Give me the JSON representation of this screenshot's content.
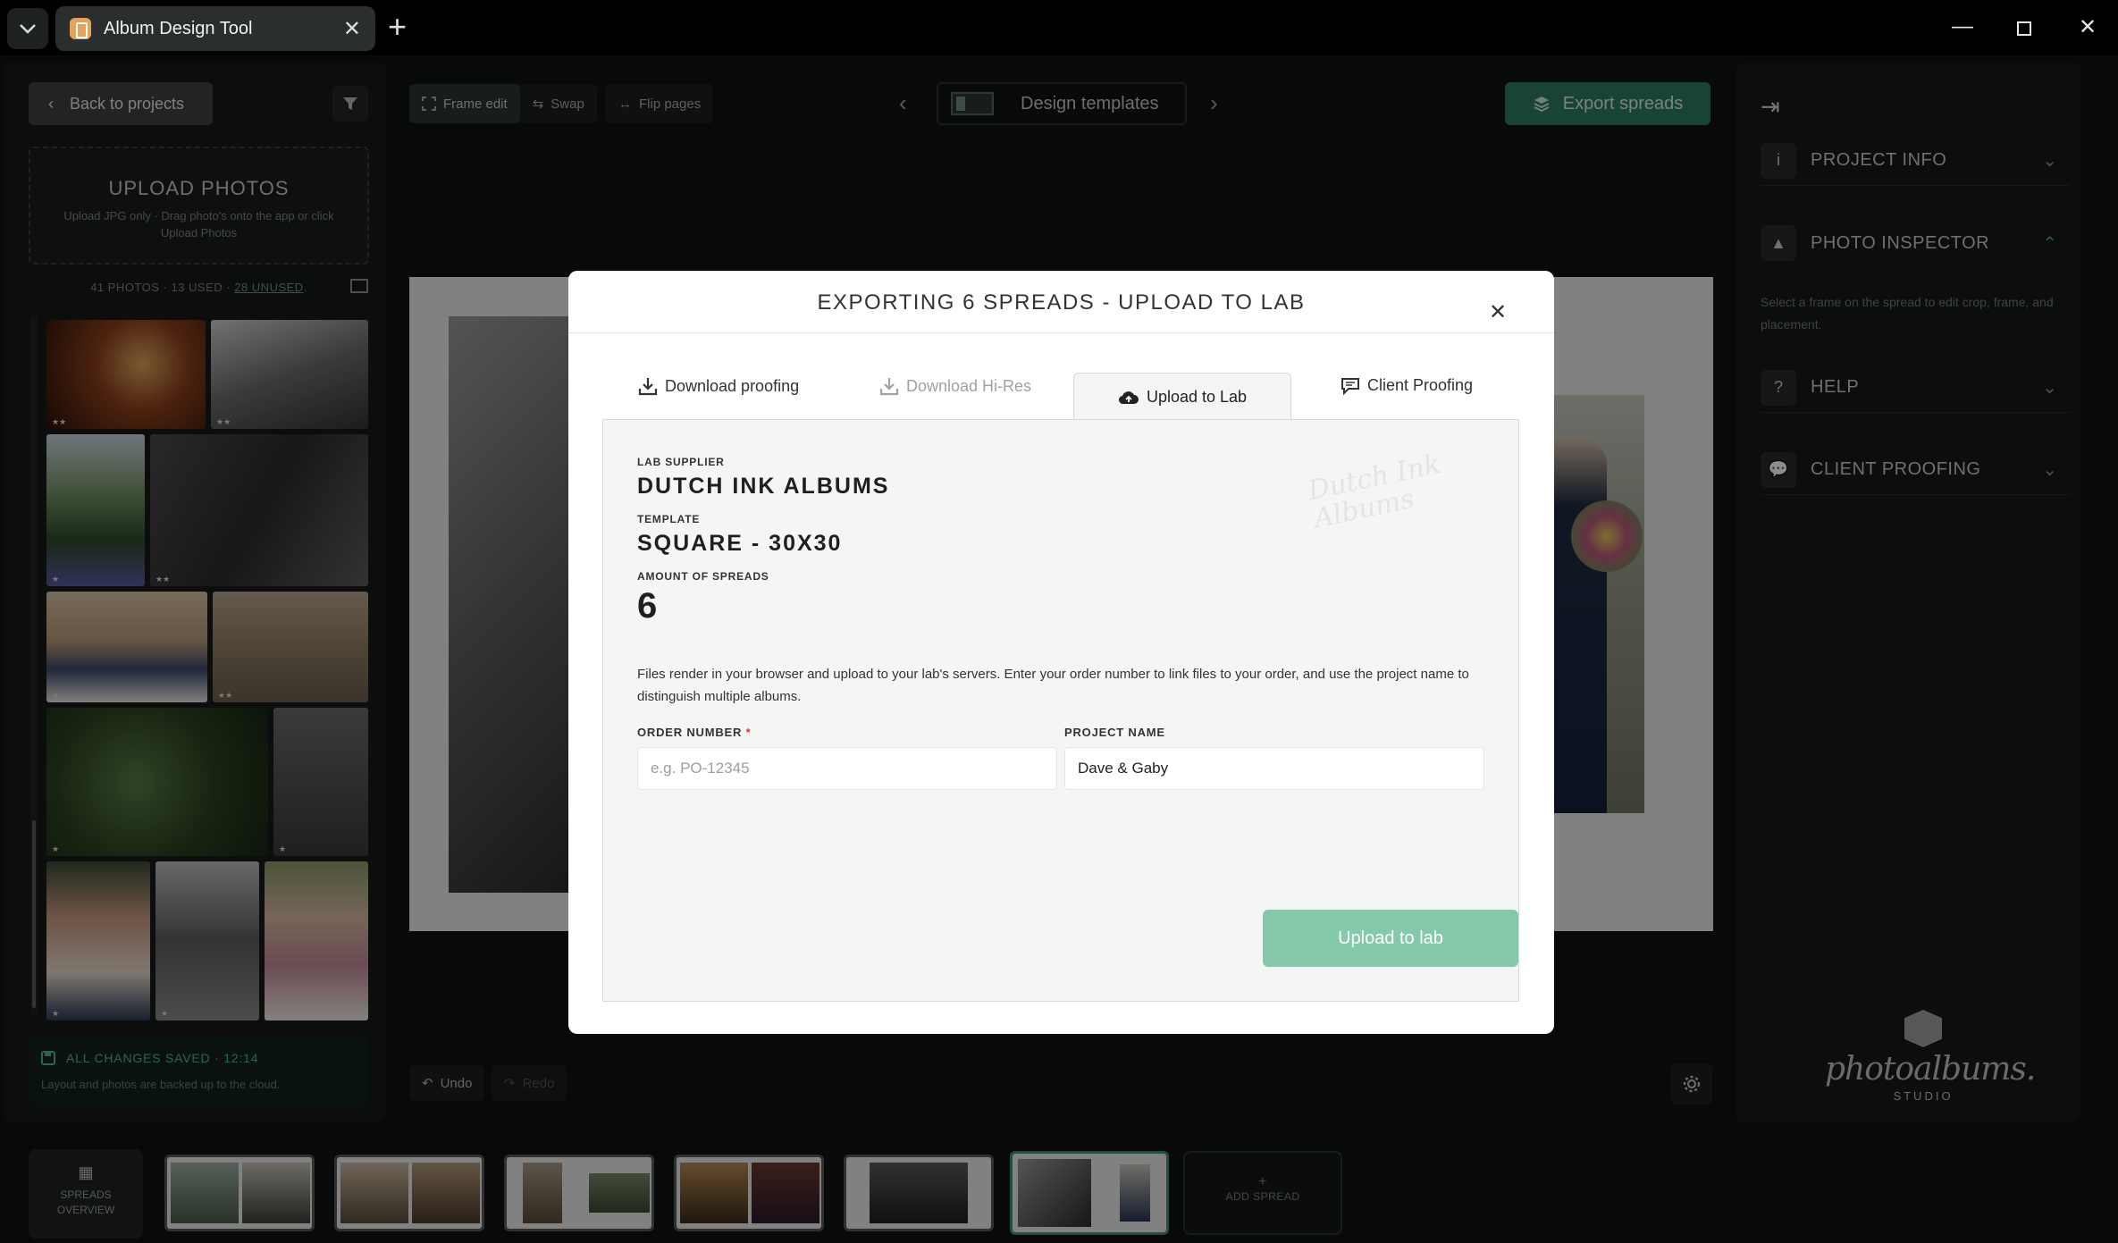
{
  "window": {
    "tab_title": "Album Design Tool",
    "icons": {
      "menu": "chevron-down-icon",
      "close_tab": "close-icon",
      "new_tab": "plus-icon",
      "minimize": "minimize-icon",
      "maximize": "maximize-icon",
      "close_window": "close-icon"
    }
  },
  "left": {
    "back_label": "Back to projects",
    "upload_title": "UPLOAD PHOTOS",
    "upload_sub": "Upload JPG only · Drag photo's onto the app or click Upload Photos",
    "stats_prefix": "41 PHOTOS · 13 USED · ",
    "stats_unused": "28 UNUSED",
    "stats_suffix": ".",
    "saved_title": "ALL CHANGES SAVED · 12:14",
    "saved_sub": "Layout and photos are backed up to the cloud."
  },
  "toolbar": {
    "frame_edit": "Frame edit",
    "swap": "Swap",
    "flip_pages": "Flip pages",
    "design_templates": "Design templates",
    "export": "Export spreads",
    "undo": "Undo",
    "redo": "Redo"
  },
  "right": {
    "sections": {
      "project_info": "PROJECT INFO",
      "photo_inspector": "PHOTO INSPECTOR",
      "help": "HELP",
      "client_proofing": "CLIENT PROOFING"
    },
    "inspector_note": "Select a frame on the spread to edit crop, frame, and placement.",
    "brand_name": "photoalbums.",
    "brand_sub": "STUDIO"
  },
  "bottom": {
    "spreads_overview_line1": "SPREADS",
    "spreads_overview_line2": "OVERVIEW",
    "add_spread_plus": "+",
    "add_spread": "ADD SPREAD"
  },
  "modal": {
    "title": "EXPORTING 6 SPREADS - UPLOAD TO LAB",
    "tabs": {
      "download_proofing": "Download proofing",
      "download_hires": "Download Hi-Res",
      "upload_to_lab": "Upload to Lab",
      "client_proofing": "Client Proofing"
    },
    "lab_supplier_label": "LAB SUPPLIER",
    "lab_supplier": "DUTCH INK ALBUMS",
    "template_label": "TEMPLATE",
    "template": "SQUARE - 30X30",
    "spreads_label": "AMOUNT OF SPREADS",
    "spreads": "6",
    "watermark": "Dutch Ink Albums",
    "description": "Files render in your browser and upload to your lab's servers. Enter your order number to link files to your order, and use the project name to distinguish multiple albums.",
    "order_label": "ORDER NUMBER",
    "order_required": "*",
    "order_placeholder": "e.g. PO-12345",
    "order_value": "",
    "project_label": "PROJECT NAME",
    "project_value": "Dave & Gaby",
    "upload_button": "Upload to lab"
  },
  "colors": {
    "accent": "#2f7a5b",
    "accent_light": "#84c9a9",
    "required": "#d23c3c"
  }
}
